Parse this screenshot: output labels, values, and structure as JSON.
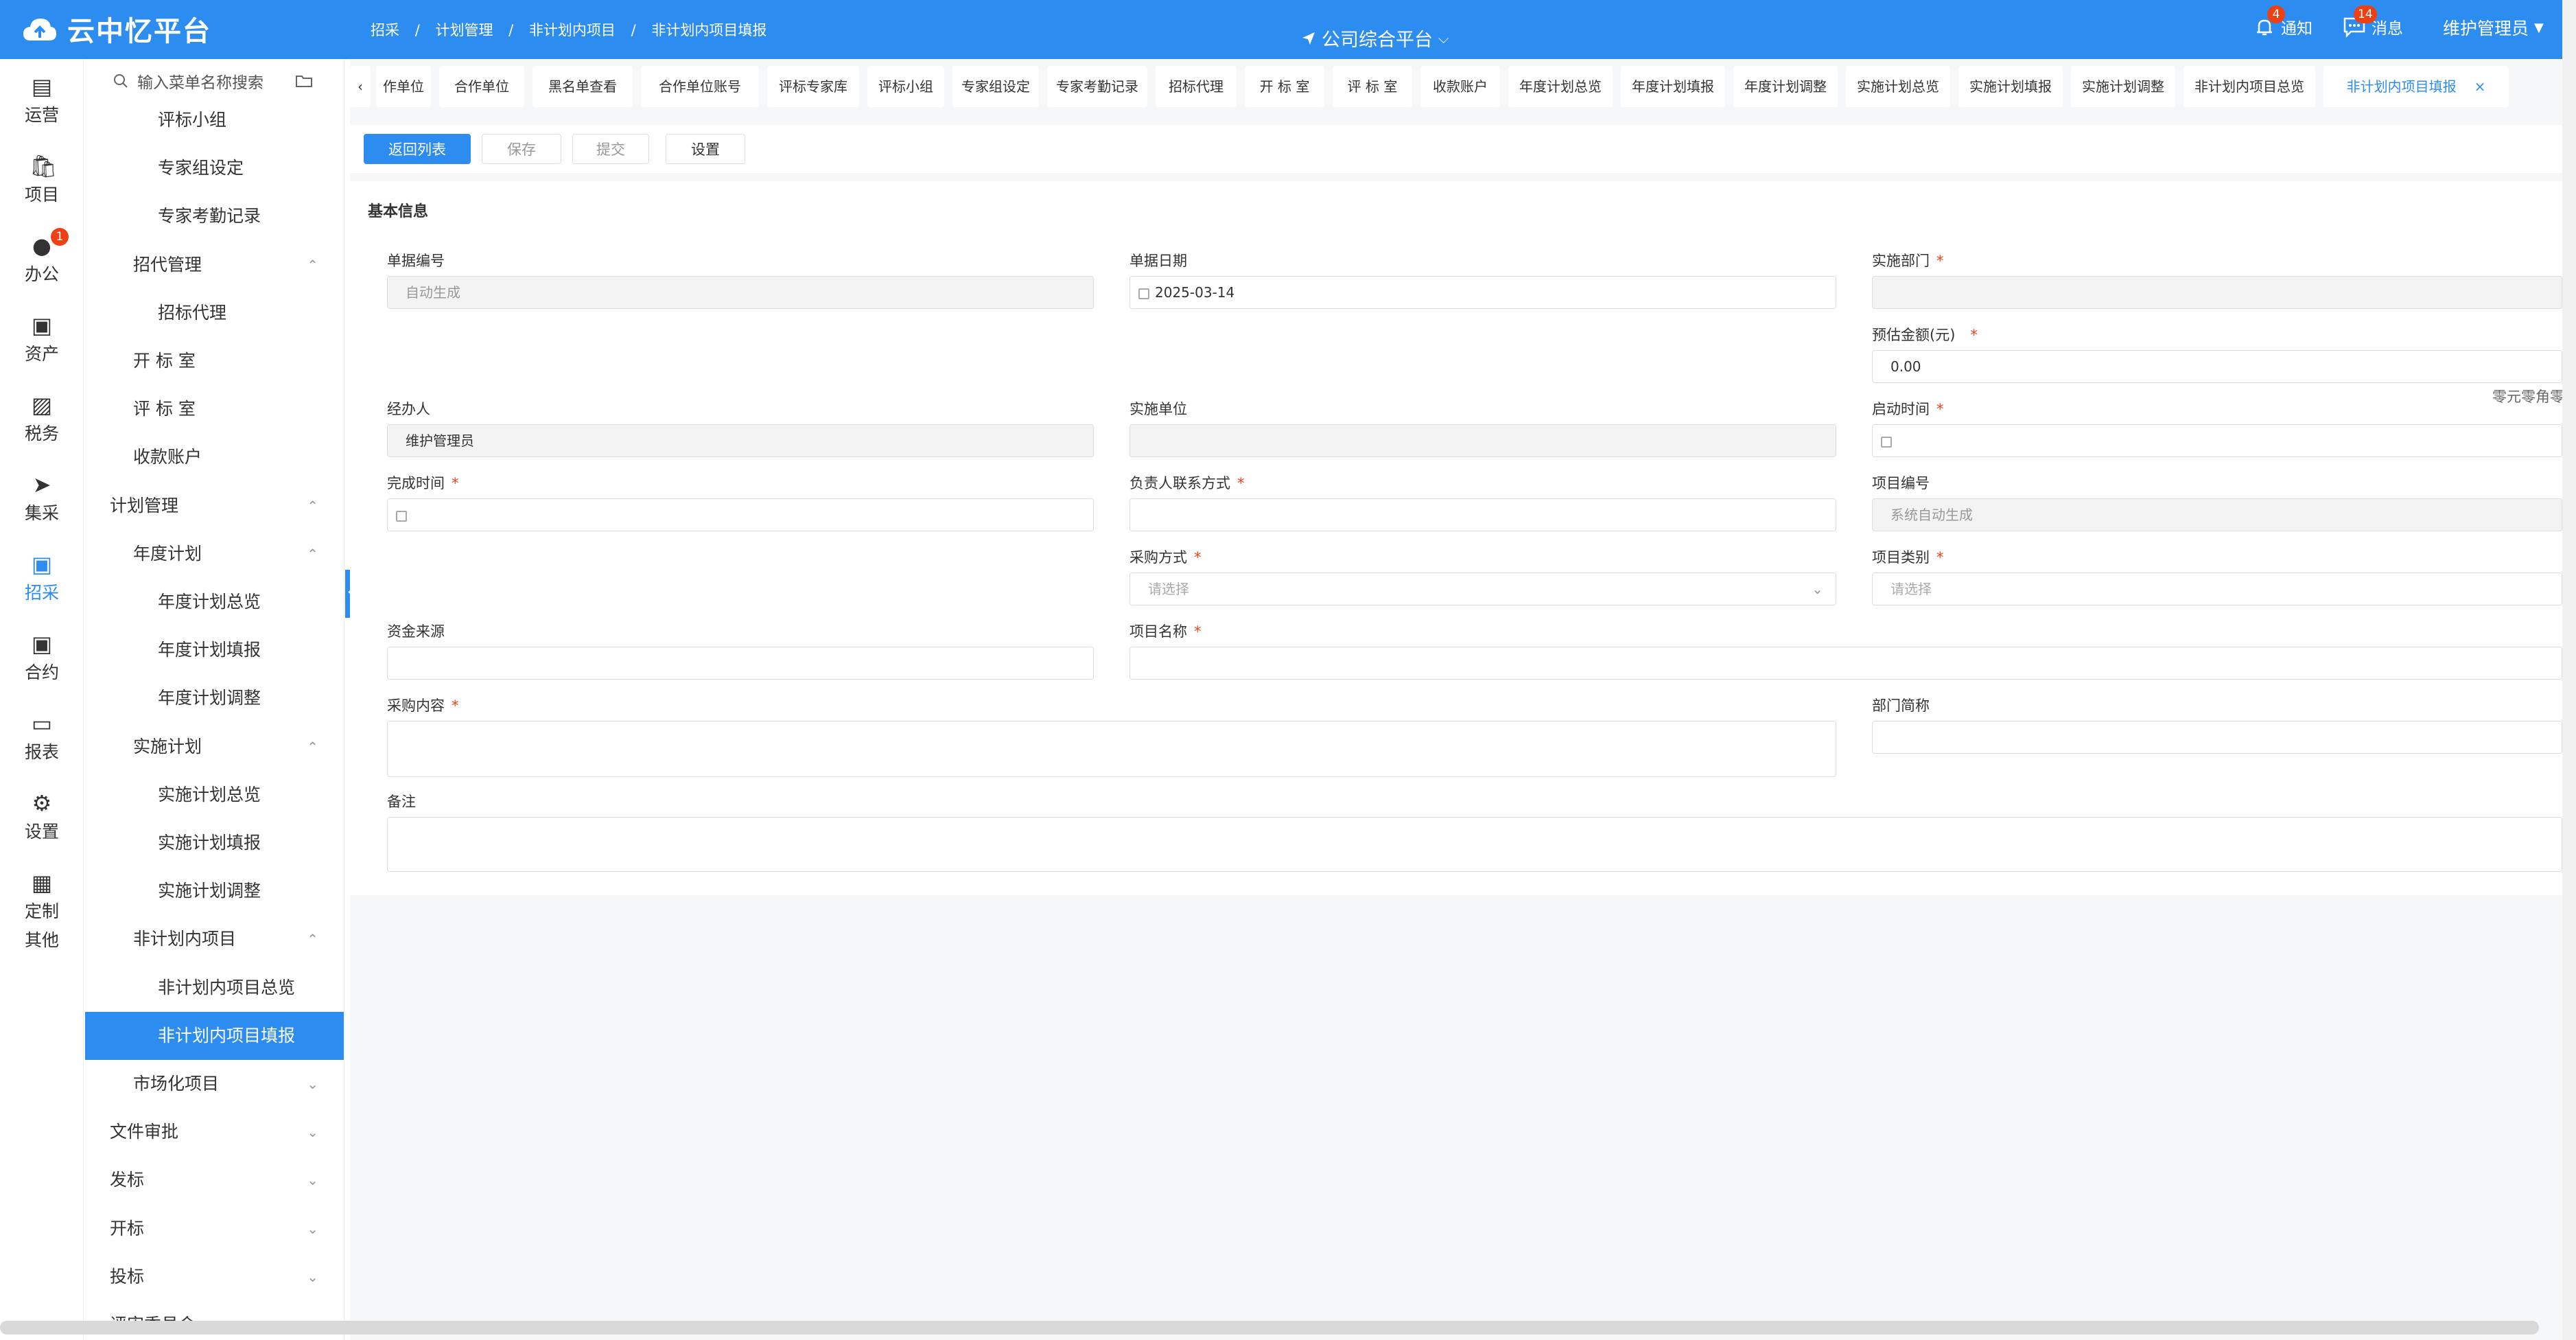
{
  "app": {
    "logo_text": "云中忆平台",
    "platform": "公司综合平台",
    "notify_label": "通知",
    "notify_count": "4",
    "msg_label": "消息",
    "msg_count": "14",
    "user": "维护管理员"
  },
  "breadcrumb": [
    "招采",
    "/",
    "计划管理",
    "/",
    "非计划内项目",
    "/",
    "非计划内项目填报"
  ],
  "rail": [
    {
      "label": "运营",
      "icon": "server-icon"
    },
    {
      "label": "项目",
      "icon": "bag-icon"
    },
    {
      "label": "办公",
      "icon": "user-icon",
      "badge": "1"
    },
    {
      "label": "资产",
      "icon": "briefcase-icon"
    },
    {
      "label": "税务",
      "icon": "wallet-icon"
    },
    {
      "label": "集采",
      "icon": "send-icon"
    },
    {
      "label": "招采",
      "icon": "suitcase-icon",
      "active": true
    },
    {
      "label": "合约",
      "icon": "case-icon"
    },
    {
      "label": "报表",
      "icon": "monitor-icon"
    },
    {
      "label": "设置",
      "icon": "gear-icon"
    },
    {
      "label": "定制",
      "icon": "grid-icon"
    },
    {
      "label": "其他",
      "icon": ""
    }
  ],
  "menu": {
    "search_placeholder": "输入菜单名称搜索",
    "items": [
      {
        "label": "评标小组",
        "level": 3
      },
      {
        "label": "专家组设定",
        "level": 3
      },
      {
        "label": "专家考勤记录",
        "level": 3
      },
      {
        "label": "招代管理",
        "level": 2,
        "chev": "up"
      },
      {
        "label": "招标代理",
        "level": 3
      },
      {
        "label": "开 标 室",
        "level": 2
      },
      {
        "label": "评 标 室",
        "level": 2
      },
      {
        "label": "收款账户",
        "level": 2
      },
      {
        "label": "计划管理",
        "level": 1,
        "chev": "up"
      },
      {
        "label": "年度计划",
        "level": 2,
        "chev": "up"
      },
      {
        "label": "年度计划总览",
        "level": 3
      },
      {
        "label": "年度计划填报",
        "level": 3
      },
      {
        "label": "年度计划调整",
        "level": 3
      },
      {
        "label": "实施计划",
        "level": 2,
        "chev": "up"
      },
      {
        "label": "实施计划总览",
        "level": 3
      },
      {
        "label": "实施计划填报",
        "level": 3
      },
      {
        "label": "实施计划调整",
        "level": 3
      },
      {
        "label": "非计划内项目",
        "level": 2,
        "chev": "up"
      },
      {
        "label": "非计划内项目总览",
        "level": 3
      },
      {
        "label": "非计划内项目填报",
        "level": 3,
        "active": true
      },
      {
        "label": "市场化项目",
        "level": 2,
        "chev": "down"
      },
      {
        "label": "文件审批",
        "level": 1,
        "chev": "down"
      },
      {
        "label": "发标",
        "level": 1,
        "chev": "down"
      },
      {
        "label": "开标",
        "level": 1,
        "chev": "down"
      },
      {
        "label": "投标",
        "level": 1,
        "chev": "down"
      },
      {
        "label": "评审委员会",
        "level": 1,
        "chev": "down"
      }
    ]
  },
  "tabs": [
    "作单位",
    "合作单位",
    "黑名单查看",
    "合作单位账号",
    "评标专家库",
    "评标小组",
    "专家组设定",
    "专家考勤记录",
    "招标代理",
    "开 标 室",
    "评 标 室",
    "收款账户",
    "年度计划总览",
    "年度计划填报",
    "年度计划调整",
    "实施计划总览",
    "实施计划填报",
    "实施计划调整",
    "非计划内项目总览",
    "非计划内项目填报"
  ],
  "toolbar": {
    "back": "返回列表",
    "save": "保存",
    "submit": "提交",
    "settings": "设置"
  },
  "form": {
    "section": "基本信息",
    "doc_no_label": "单据编号",
    "doc_no_value": "自动生成",
    "doc_date_label": "单据日期",
    "doc_date_value": "2025-03-14",
    "dept_label": "实施部门",
    "amount_label": "预估金额(元)",
    "amount_value": "0.00",
    "amount_caps": "零元零角零",
    "handler_label": "经办人",
    "handler_value": "维护管理员",
    "unit_label": "实施单位",
    "start_label": "启动时间",
    "finish_label": "完成时间",
    "contact_label": "负责人联系方式",
    "proj_no_label": "项目编号",
    "proj_no_value": "系统自动生成",
    "method_label": "采购方式",
    "method_placeholder": "请选择",
    "category_label": "项目类别",
    "category_placeholder": "请选择",
    "fund_label": "资金来源",
    "proj_name_label": "项目名称",
    "content_label": "采购内容",
    "dept_short_label": "部门简称",
    "remark_label": "备注"
  }
}
